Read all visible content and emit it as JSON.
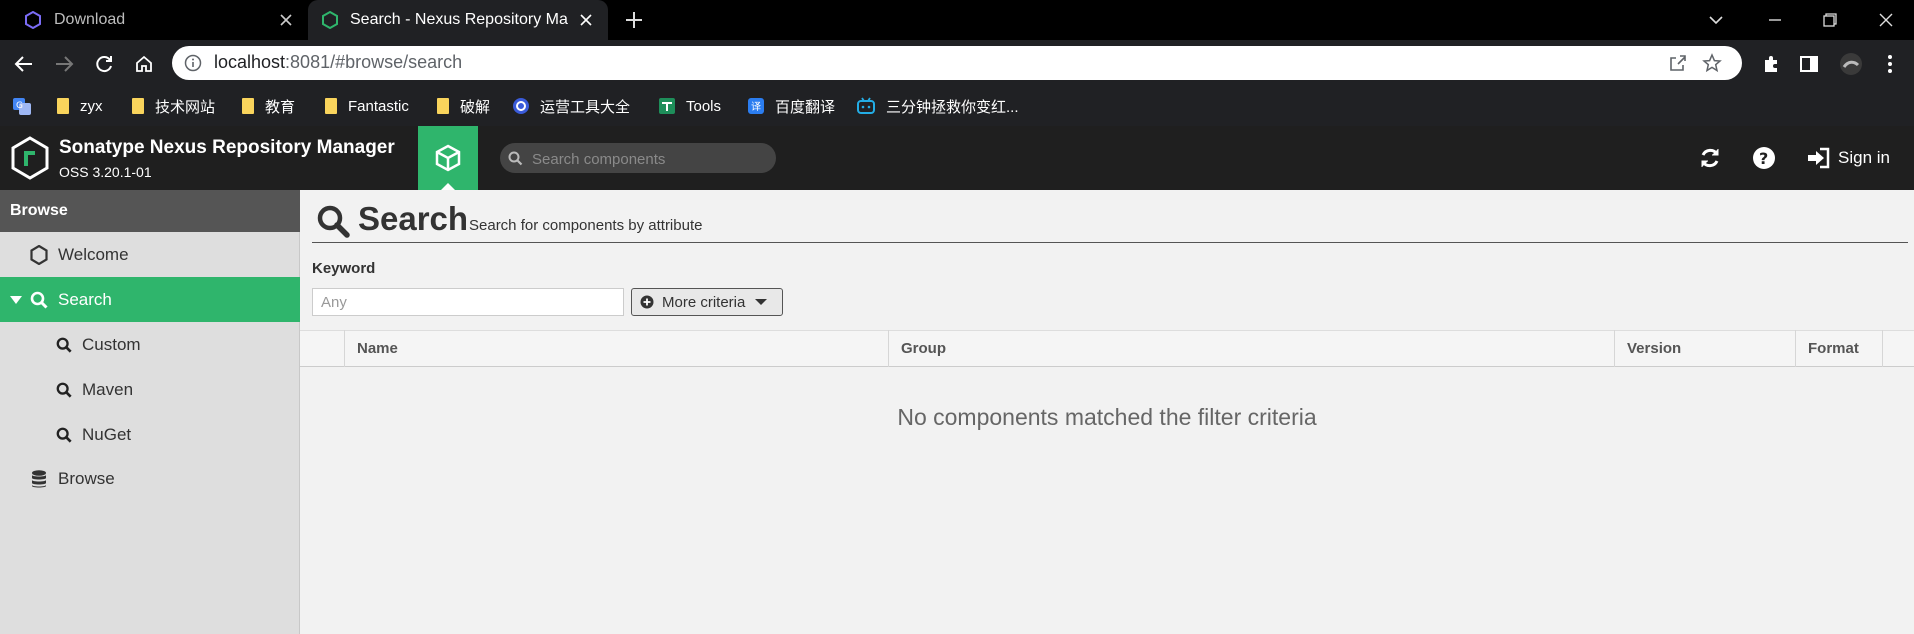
{
  "browser": {
    "tabs": [
      {
        "title": "Download",
        "active": false,
        "icon": "hexagon-icon"
      },
      {
        "title": "Search - Nexus Repository Ma",
        "active": true,
        "icon": "nexus-logo-icon"
      }
    ],
    "url_host": "localhost",
    "url_rest": ":8081/#browse/search",
    "bookmarks": [
      {
        "label": "",
        "icon": "translate-icon"
      },
      {
        "label": "zyx",
        "icon": "folder-icon"
      },
      {
        "label": "技术网站",
        "icon": "folder-icon"
      },
      {
        "label": "教育",
        "icon": "folder-icon"
      },
      {
        "label": "Fantastic",
        "icon": "folder-icon"
      },
      {
        "label": "破解",
        "icon": "folder-icon"
      },
      {
        "label": "运营工具大全",
        "icon": "circle-logo-icon"
      },
      {
        "label": "Tools",
        "icon": "tools-icon"
      },
      {
        "label": "百度翻译",
        "icon": "baidu-translate-icon"
      },
      {
        "label": "三分钟拯救你变红...",
        "icon": "bilibili-icon"
      }
    ]
  },
  "app": {
    "title": "Sonatype Nexus Repository Manager",
    "version": "OSS 3.20.1-01",
    "search_placeholder": "Search components",
    "sign_in": "Sign in"
  },
  "sidebar": {
    "header": "Browse",
    "items": [
      {
        "label": "Welcome",
        "icon": "hexagon-icon"
      },
      {
        "label": "Search",
        "icon": "search-icon",
        "active": true
      },
      {
        "label": "Custom",
        "icon": "search-icon"
      },
      {
        "label": "Maven",
        "icon": "search-icon"
      },
      {
        "label": "NuGet",
        "icon": "search-icon"
      },
      {
        "label": "Browse",
        "icon": "database-icon"
      }
    ]
  },
  "main": {
    "title": "Search",
    "subtitle": "Search for components by attribute",
    "keyword_label": "Keyword",
    "keyword_placeholder": "Any",
    "more_criteria": "More criteria",
    "columns": [
      "Name",
      "Group",
      "Version",
      "Format"
    ],
    "empty_message": "No components matched the filter criteria"
  },
  "colors": {
    "accent": "#2fb56c",
    "header_bg": "#1f1f1f",
    "sidebar_bg": "#dedede"
  }
}
